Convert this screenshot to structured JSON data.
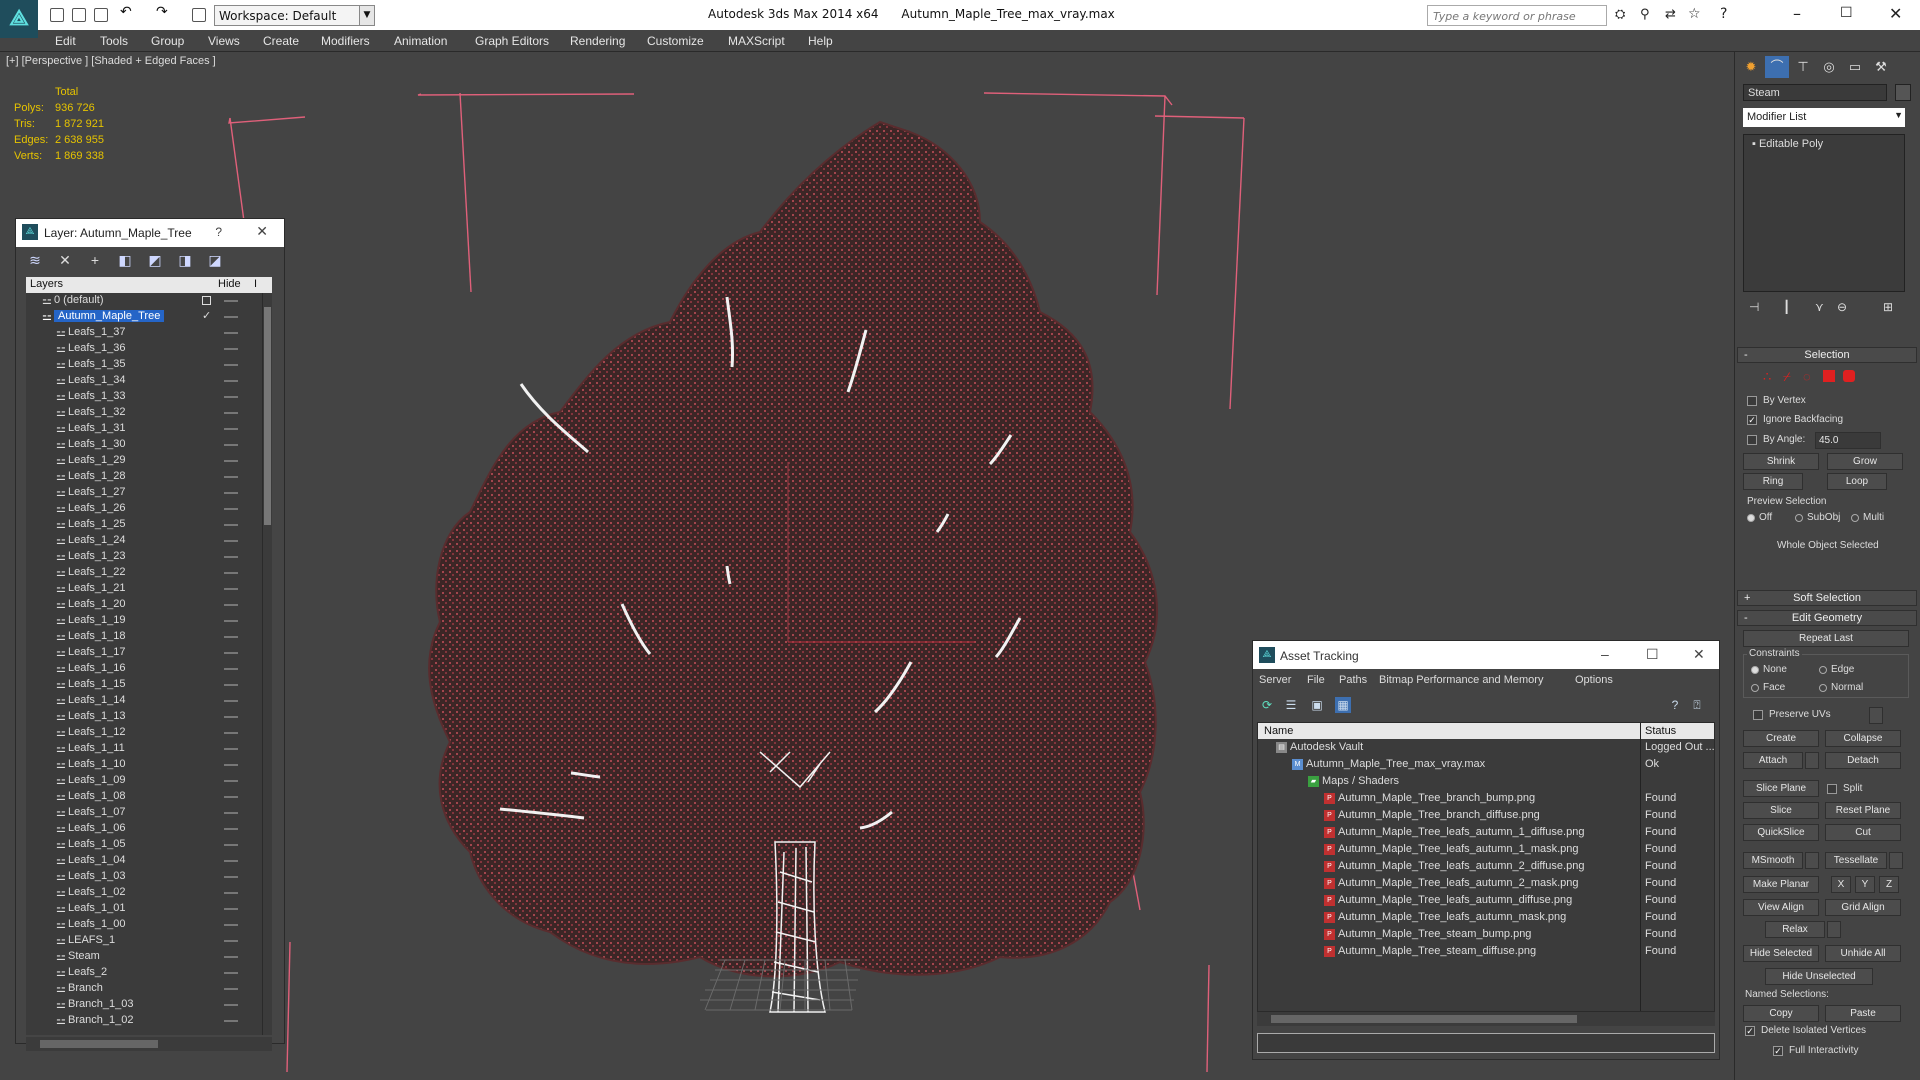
{
  "app": {
    "title": "Autodesk 3ds Max 2014 x64      Autumn_Maple_Tree_max_vray.max",
    "workspace": "Workspace: Default",
    "search_placeholder": "Type a keyword or phrase"
  },
  "menu": [
    "Edit",
    "Tools",
    "Group",
    "Views",
    "Create",
    "Modifiers",
    "Animation",
    "Graph Editors",
    "Rendering",
    "Customize",
    "MAXScript",
    "Help"
  ],
  "viewport": {
    "label": "[+] [Perspective ] [Shaded + Edged Faces ]",
    "stats": {
      "header": "Total",
      "rows": [
        {
          "label": "Polys:",
          "value": "936 726"
        },
        {
          "label": "Tris:",
          "value": "1 872 921"
        },
        {
          "label": "Edges:",
          "value": "2 638 955"
        },
        {
          "label": "Verts:",
          "value": "1 869 338"
        }
      ]
    }
  },
  "layer_panel": {
    "title": "Layer: Autumn_Maple_Tree",
    "help": "?",
    "col_layers": "Layers",
    "col_hide": "Hide",
    "col_extra": "I",
    "items": [
      {
        "name": "0 (default)",
        "level": 1
      },
      {
        "name": "Autumn_Maple_Tree",
        "level": 1,
        "selected": true
      },
      {
        "name": "Leafs_1_37",
        "level": 2
      },
      {
        "name": "Leafs_1_36",
        "level": 2
      },
      {
        "name": "Leafs_1_35",
        "level": 2
      },
      {
        "name": "Leafs_1_34",
        "level": 2
      },
      {
        "name": "Leafs_1_33",
        "level": 2
      },
      {
        "name": "Leafs_1_32",
        "level": 2
      },
      {
        "name": "Leafs_1_31",
        "level": 2
      },
      {
        "name": "Leafs_1_30",
        "level": 2
      },
      {
        "name": "Leafs_1_29",
        "level": 2
      },
      {
        "name": "Leafs_1_28",
        "level": 2
      },
      {
        "name": "Leafs_1_27",
        "level": 2
      },
      {
        "name": "Leafs_1_26",
        "level": 2
      },
      {
        "name": "Leafs_1_25",
        "level": 2
      },
      {
        "name": "Leafs_1_24",
        "level": 2
      },
      {
        "name": "Leafs_1_23",
        "level": 2
      },
      {
        "name": "Leafs_1_22",
        "level": 2
      },
      {
        "name": "Leafs_1_21",
        "level": 2
      },
      {
        "name": "Leafs_1_20",
        "level": 2
      },
      {
        "name": "Leafs_1_19",
        "level": 2
      },
      {
        "name": "Leafs_1_18",
        "level": 2
      },
      {
        "name": "Leafs_1_17",
        "level": 2
      },
      {
        "name": "Leafs_1_16",
        "level": 2
      },
      {
        "name": "Leafs_1_15",
        "level": 2
      },
      {
        "name": "Leafs_1_14",
        "level": 2
      },
      {
        "name": "Leafs_1_13",
        "level": 2
      },
      {
        "name": "Leafs_1_12",
        "level": 2
      },
      {
        "name": "Leafs_1_11",
        "level": 2
      },
      {
        "name": "Leafs_1_10",
        "level": 2
      },
      {
        "name": "Leafs_1_09",
        "level": 2
      },
      {
        "name": "Leafs_1_08",
        "level": 2
      },
      {
        "name": "Leafs_1_07",
        "level": 2
      },
      {
        "name": "Leafs_1_06",
        "level": 2
      },
      {
        "name": "Leafs_1_05",
        "level": 2
      },
      {
        "name": "Leafs_1_04",
        "level": 2
      },
      {
        "name": "Leafs_1_03",
        "level": 2
      },
      {
        "name": "Leafs_1_02",
        "level": 2
      },
      {
        "name": "Leafs_1_01",
        "level": 2
      },
      {
        "name": "Leafs_1_00",
        "level": 2
      },
      {
        "name": "LEAFS_1",
        "level": 2
      },
      {
        "name": "Steam",
        "level": 2
      },
      {
        "name": "Leafs_2",
        "level": 2
      },
      {
        "name": "Branch",
        "level": 2
      },
      {
        "name": "Branch_1_03",
        "level": 2
      },
      {
        "name": "Branch_1_02",
        "level": 2
      }
    ]
  },
  "asset_tracking": {
    "title": "Asset Tracking",
    "menu": [
      "Server",
      "File",
      "Paths",
      "Bitmap Performance and Memory",
      "Options"
    ],
    "col_name": "Name",
    "col_status": "Status",
    "rows": [
      {
        "name": "Autodesk Vault",
        "status": "Logged Out ...",
        "indent": 0,
        "icon": "vault-icon"
      },
      {
        "name": "Autumn_Maple_Tree_max_vray.max",
        "status": "Ok",
        "indent": 1,
        "icon": "max-file-icon"
      },
      {
        "name": "Maps / Shaders",
        "status": "",
        "indent": 2,
        "icon": "folder-icon"
      },
      {
        "name": "Autumn_Maple_Tree_branch_bump.png",
        "status": "Found",
        "indent": 3,
        "icon": "png-icon"
      },
      {
        "name": "Autumn_Maple_Tree_branch_diffuse.png",
        "status": "Found",
        "indent": 3,
        "icon": "png-icon"
      },
      {
        "name": "Autumn_Maple_Tree_leafs_autumn_1_diffuse.png",
        "status": "Found",
        "indent": 3,
        "icon": "png-icon"
      },
      {
        "name": "Autumn_Maple_Tree_leafs_autumn_1_mask.png",
        "status": "Found",
        "indent": 3,
        "icon": "png-icon"
      },
      {
        "name": "Autumn_Maple_Tree_leafs_autumn_2_diffuse.png",
        "status": "Found",
        "indent": 3,
        "icon": "png-icon"
      },
      {
        "name": "Autumn_Maple_Tree_leafs_autumn_2_mask.png",
        "status": "Found",
        "indent": 3,
        "icon": "png-icon"
      },
      {
        "name": "Autumn_Maple_Tree_leafs_autumn_diffuse.png",
        "status": "Found",
        "indent": 3,
        "icon": "png-icon"
      },
      {
        "name": "Autumn_Maple_Tree_leafs_autumn_mask.png",
        "status": "Found",
        "indent": 3,
        "icon": "png-icon"
      },
      {
        "name": "Autumn_Maple_Tree_steam_bump.png",
        "status": "Found",
        "indent": 3,
        "icon": "png-icon"
      },
      {
        "name": "Autumn_Maple_Tree_steam_diffuse.png",
        "status": "Found",
        "indent": 3,
        "icon": "png-icon"
      }
    ]
  },
  "command_panel": {
    "object_name": "Steam",
    "modifier_list": "Modifier List",
    "stack_item": "Editable Poly",
    "selection": {
      "title": "Selection",
      "by_vertex": "By Vertex",
      "ignore_backfacing": "Ignore Backfacing",
      "by_angle": "By Angle:",
      "angle_value": "45.0",
      "shrink": "Shrink",
      "grow": "Grow",
      "ring": "Ring",
      "loop": "Loop",
      "preview_selection": "Preview Selection",
      "off": "Off",
      "subobj": "SubObj",
      "multi": "Multi",
      "whole_object": "Whole Object Selected"
    },
    "soft_selection": "Soft Selection",
    "edit_geometry": {
      "title": "Edit Geometry",
      "repeat_last": "Repeat Last",
      "constraints": "Constraints",
      "none": "None",
      "edge": "Edge",
      "face": "Face",
      "normal": "Normal",
      "preserve_uvs": "Preserve UVs",
      "create": "Create",
      "collapse": "Collapse",
      "attach": "Attach",
      "detach": "Detach",
      "slice_plane": "Slice Plane",
      "split": "Split",
      "slice": "Slice",
      "reset_plane": "Reset Plane",
      "quickslice": "QuickSlice",
      "cut": "Cut",
      "msmooth": "MSmooth",
      "tessellate": "Tessellate",
      "make_planar": "Make Planar",
      "x": "X",
      "y": "Y",
      "z": "Z",
      "view_align": "View Align",
      "grid_align": "Grid Align",
      "relax": "Relax",
      "hide_selected": "Hide Selected",
      "unhide_all": "Unhide All",
      "hide_unselected": "Hide Unselected",
      "named_selections": "Named Selections:",
      "copy": "Copy",
      "paste": "Paste",
      "delete_isolated": "Delete Isolated Vertices",
      "full_interactivity": "Full Interactivity"
    }
  },
  "colors": {
    "bg": "#444444",
    "stats": "#e6c300",
    "selection": "#2565c7",
    "leaf": "#7a3a3c",
    "bbox": "#e0607a"
  }
}
